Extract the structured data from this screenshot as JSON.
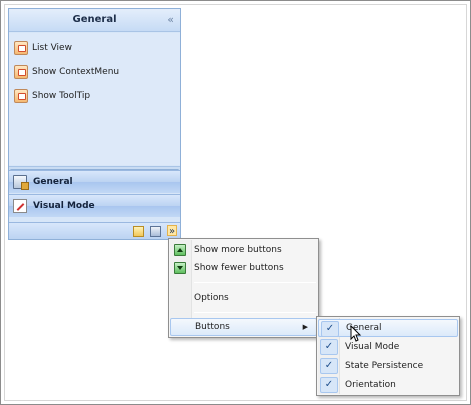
{
  "nav_pane": {
    "header_title": "General",
    "collapse_glyph": "«",
    "items": [
      {
        "label": "List View",
        "icon": "picture-icon"
      },
      {
        "label": "Show ContextMenu",
        "icon": "picture-icon"
      },
      {
        "label": "Show ToolTip",
        "icon": "picture-icon"
      }
    ],
    "groups": [
      {
        "label": "General",
        "icon": "general-icon"
      },
      {
        "label": "Visual Mode",
        "icon": "visual-mode-icon"
      }
    ],
    "footer": {
      "buttons": [
        "folder-icon",
        "map-icon"
      ],
      "chevron_glyph": "»"
    }
  },
  "context_menu": {
    "items": [
      {
        "label": "Show more buttons",
        "icon": "arrow-up-icon"
      },
      {
        "label": "Show fewer buttons",
        "icon": "arrow-down-icon"
      },
      {
        "label": "Options"
      },
      {
        "label": "Buttons",
        "has_submenu": true
      }
    ],
    "submenu_arrow": "▶"
  },
  "submenu": {
    "check_glyph": "✓",
    "items": [
      {
        "label": "General",
        "checked": true
      },
      {
        "label": "Visual Mode",
        "checked": true
      },
      {
        "label": "State Persistence",
        "checked": true
      },
      {
        "label": "Orientation",
        "checked": true
      }
    ]
  },
  "colors": {
    "header_gradient": [
      "#e4eefb",
      "#c6dbf5"
    ],
    "highlight_border": "#a8c7ef",
    "check_color": "#1f4f8c"
  }
}
